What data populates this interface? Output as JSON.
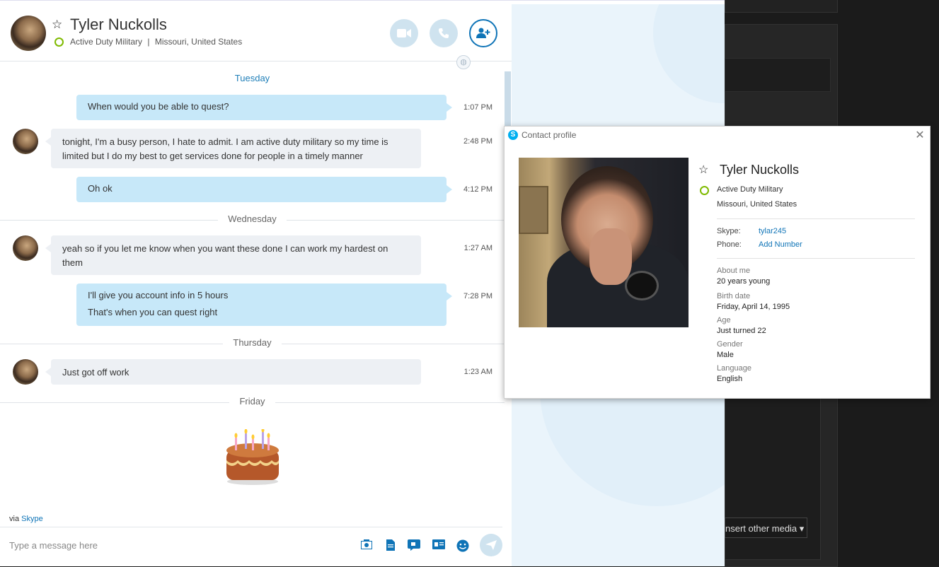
{
  "header": {
    "name": "Tyler Nuckolls",
    "mood": "Active Duty Military",
    "separator": "|",
    "location": "Missouri, United States"
  },
  "conversation": {
    "days": [
      "Tuesday",
      "Wednesday",
      "Thursday",
      "Friday"
    ],
    "messages": [
      {
        "text": "When would you be able to quest?",
        "time": "1:07 PM"
      },
      {
        "text": "tonight, I'm a busy person, I hate to admit. I am active duty military so my time is limited but I do my best to get services done for people in a timely manner",
        "time": "2:48 PM"
      },
      {
        "text": "Oh ok",
        "time": "4:12 PM"
      },
      {
        "text": "yeah so if you let me know when you want these done I can work my hardest on them",
        "time": "1:27 AM"
      },
      {
        "text": "I'll give you account info in 5 hours",
        "text2": "That's when you can quest right",
        "time": "7:28 PM"
      },
      {
        "text": "Just got off work",
        "time": "1:23 AM"
      }
    ]
  },
  "footer": {
    "via": "via",
    "via_link": "Skype",
    "compose_placeholder": "Type a message here"
  },
  "profile": {
    "title": "Contact profile",
    "name": "Tyler Nuckolls",
    "mood": "Active Duty Military",
    "location": "Missouri, United States",
    "skype_label": "Skype:",
    "skype_value": "tylar245",
    "phone_label": "Phone:",
    "phone_value": "Add Number",
    "about_label": "About me",
    "about_value": "20 years young",
    "birth_label": "Birth date",
    "birth_value": "Friday, April 14, 1995",
    "age_label": "Age",
    "age_value": "Just turned 22",
    "gender_label": "Gender",
    "gender_value": "Male",
    "language_label": "Language",
    "language_value": "English"
  },
  "background_app": {
    "insert_media_label": "nsert other media ▾"
  },
  "colors": {
    "accent": "#0f74b7",
    "outgoing_bubble": "#c7e8f9",
    "incoming_bubble": "#edf0f4",
    "online": "#7fba00"
  }
}
